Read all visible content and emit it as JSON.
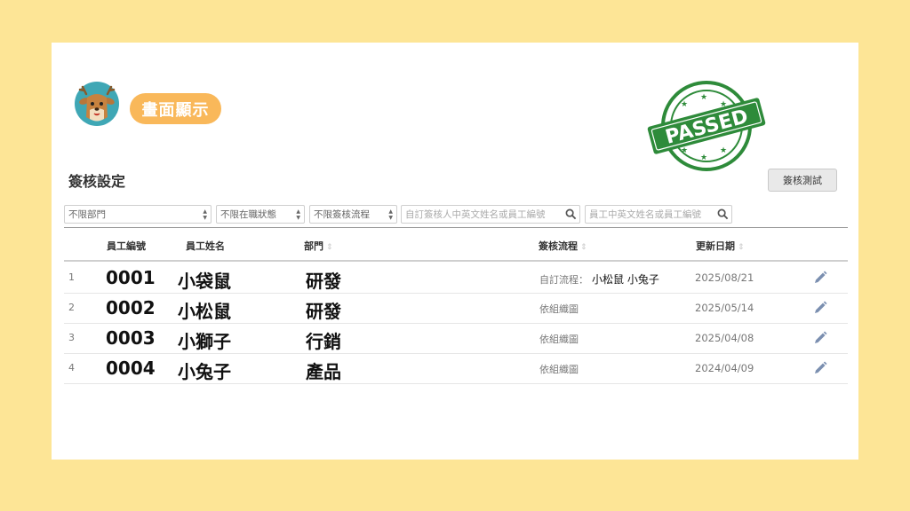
{
  "header": {
    "badge_label": "畫面顯示",
    "stamp_text": "PASSED"
  },
  "page": {
    "title": "簽核設定",
    "test_button": "簽核測試"
  },
  "filters": {
    "department": "不限部門",
    "employment_status": "不限在職狀態",
    "approval_flow": "不限簽核流程",
    "custom_approver_placeholder": "自訂簽核人中英文姓名或員工編號",
    "employee_search_placeholder": "員工中英文姓名或員工編號"
  },
  "table": {
    "columns": {
      "employee_id": "員工編號",
      "employee_name": "員工姓名",
      "department": "部門",
      "approval_flow": "簽核流程",
      "updated_date": "更新日期"
    },
    "rows": [
      {
        "index": "1",
        "employee_id": "0001",
        "name": "小袋鼠",
        "department": "研發",
        "flow": "自訂流程：",
        "flow_people": "小松鼠  小兔子",
        "date": "2025/08/21"
      },
      {
        "index": "2",
        "employee_id": "0002",
        "name": "小松鼠",
        "department": "研發",
        "flow": "依組織圖",
        "flow_people": "",
        "date": "2025/05/14"
      },
      {
        "index": "3",
        "employee_id": "0003",
        "name": "小獅子",
        "department": "行銷",
        "flow": "依組織圖",
        "flow_people": "",
        "date": "2025/04/08"
      },
      {
        "index": "4",
        "employee_id": "0004",
        "name": "小兔子",
        "department": "產品",
        "flow": "依組織圖",
        "flow_people": "",
        "date": "2024/04/09"
      }
    ]
  },
  "colors": {
    "background": "#fde596",
    "badge": "#f9b85a",
    "stamp_green": "#2e8b3a",
    "avatar_bg": "#3fa7b5",
    "edit_icon": "#7b8fb0"
  },
  "icons": {
    "avatar": "deer-avatar-icon",
    "stamp": "passed-stamp-icon",
    "search": "search-icon",
    "edit": "pencil-icon",
    "select": "select-arrows-icon",
    "sort": "sort-arrows-icon"
  }
}
